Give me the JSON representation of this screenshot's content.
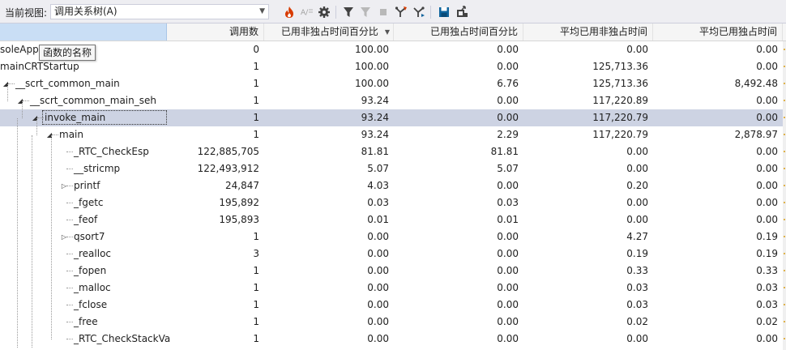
{
  "toolbar": {
    "view_label": "当前视图:",
    "view_value": "调用关系树(A)",
    "icons": [
      "flame-icon",
      "noise-reduction-icon",
      "gear-icon",
      "filter-icon",
      "clear-filter-icon",
      "stop-icon",
      "expand-hot-path-icon",
      "show-hot-path-icon",
      "save-icon",
      "export-icon"
    ]
  },
  "columns": {
    "name": "",
    "calls": "调用数",
    "incl_pct": "已用非独占时间百分比",
    "excl_pct": "已用独占时间百分比",
    "avg_incl": "平均已用非独占时间",
    "avg_excl": "平均已用独占时间"
  },
  "tooltip": "函数的名称",
  "colors": {
    "header_selected": "#c9def5",
    "row_selected": "#cdd3e3",
    "flame": "#d83b01",
    "accent": "#0e639c"
  },
  "rows": [
    {
      "name": "ConsoleApp",
      "display": "soleApp",
      "calls": "0",
      "incl": "100.00",
      "excl": "0.00",
      "avg_incl": "0.00",
      "avg_excl": "0.00",
      "depth": -1,
      "expander": ""
    },
    {
      "name": "mainCRTStartup",
      "display": "mainCRTStartup",
      "calls": "1",
      "incl": "100.00",
      "excl": "0.00",
      "avg_incl": "125,713.36",
      "avg_excl": "0.00",
      "depth": -1,
      "expander": ""
    },
    {
      "name": "__scrt_common_main",
      "display": "__scrt_common_main",
      "calls": "1",
      "incl": "100.00",
      "excl": "6.76",
      "avg_incl": "125,713.36",
      "avg_excl": "8,492.48",
      "depth": 0,
      "expander": "open"
    },
    {
      "name": "__scrt_common_main_seh",
      "display": "__scrt_common_main_seh",
      "calls": "1",
      "incl": "93.24",
      "excl": "0.00",
      "avg_incl": "117,220.89",
      "avg_excl": "0.00",
      "depth": 1,
      "expander": "open"
    },
    {
      "name": "invoke_main",
      "display": "invoke_main",
      "calls": "1",
      "incl": "93.24",
      "excl": "0.00",
      "avg_incl": "117,220.79",
      "avg_excl": "0.00",
      "depth": 2,
      "expander": "open",
      "selected": true
    },
    {
      "name": "main",
      "display": "main",
      "calls": "1",
      "incl": "93.24",
      "excl": "2.29",
      "avg_incl": "117,220.79",
      "avg_excl": "2,878.97",
      "depth": 3,
      "expander": "open"
    },
    {
      "name": "_RTC_CheckEsp",
      "display": "_RTC_CheckEsp",
      "calls": "122,885,705",
      "incl": "81.81",
      "excl": "81.81",
      "avg_incl": "0.00",
      "avg_excl": "0.00",
      "depth": 4,
      "expander": ""
    },
    {
      "name": "__stricmp",
      "display": "__stricmp",
      "calls": "122,493,912",
      "incl": "5.07",
      "excl": "5.07",
      "avg_incl": "0.00",
      "avg_excl": "0.00",
      "depth": 4,
      "expander": ""
    },
    {
      "name": "printf",
      "display": "printf",
      "calls": "24,847",
      "incl": "4.03",
      "excl": "0.00",
      "avg_incl": "0.20",
      "avg_excl": "0.00",
      "depth": 4,
      "expander": "closed"
    },
    {
      "name": "_fgetc",
      "display": "_fgetc",
      "calls": "195,892",
      "incl": "0.03",
      "excl": "0.03",
      "avg_incl": "0.00",
      "avg_excl": "0.00",
      "depth": 4,
      "expander": ""
    },
    {
      "name": "_feof",
      "display": "_feof",
      "calls": "195,893",
      "incl": "0.01",
      "excl": "0.01",
      "avg_incl": "0.00",
      "avg_excl": "0.00",
      "depth": 4,
      "expander": ""
    },
    {
      "name": "qsort7",
      "display": "qsort7",
      "calls": "1",
      "incl": "0.00",
      "excl": "0.00",
      "avg_incl": "4.27",
      "avg_excl": "0.19",
      "depth": 4,
      "expander": "closed"
    },
    {
      "name": "_realloc",
      "display": "_realloc",
      "calls": "3",
      "incl": "0.00",
      "excl": "0.00",
      "avg_incl": "0.19",
      "avg_excl": "0.19",
      "depth": 4,
      "expander": ""
    },
    {
      "name": "_fopen",
      "display": "_fopen",
      "calls": "1",
      "incl": "0.00",
      "excl": "0.00",
      "avg_incl": "0.33",
      "avg_excl": "0.33",
      "depth": 4,
      "expander": ""
    },
    {
      "name": "_malloc",
      "display": "_malloc",
      "calls": "1",
      "incl": "0.00",
      "excl": "0.00",
      "avg_incl": "0.03",
      "avg_excl": "0.03",
      "depth": 4,
      "expander": ""
    },
    {
      "name": "_fclose",
      "display": "_fclose",
      "calls": "1",
      "incl": "0.00",
      "excl": "0.00",
      "avg_incl": "0.03",
      "avg_excl": "0.03",
      "depth": 4,
      "expander": ""
    },
    {
      "name": "_free",
      "display": "_free",
      "calls": "1",
      "incl": "0.00",
      "excl": "0.00",
      "avg_incl": "0.02",
      "avg_excl": "0.02",
      "depth": 4,
      "expander": ""
    },
    {
      "name": "_RTC_CheckStackVa",
      "display": "_RTC_CheckStackVa",
      "calls": "1",
      "incl": "0.00",
      "excl": "0.00",
      "avg_incl": "0.00",
      "avg_excl": "0.00",
      "depth": 4,
      "expander": ""
    }
  ]
}
